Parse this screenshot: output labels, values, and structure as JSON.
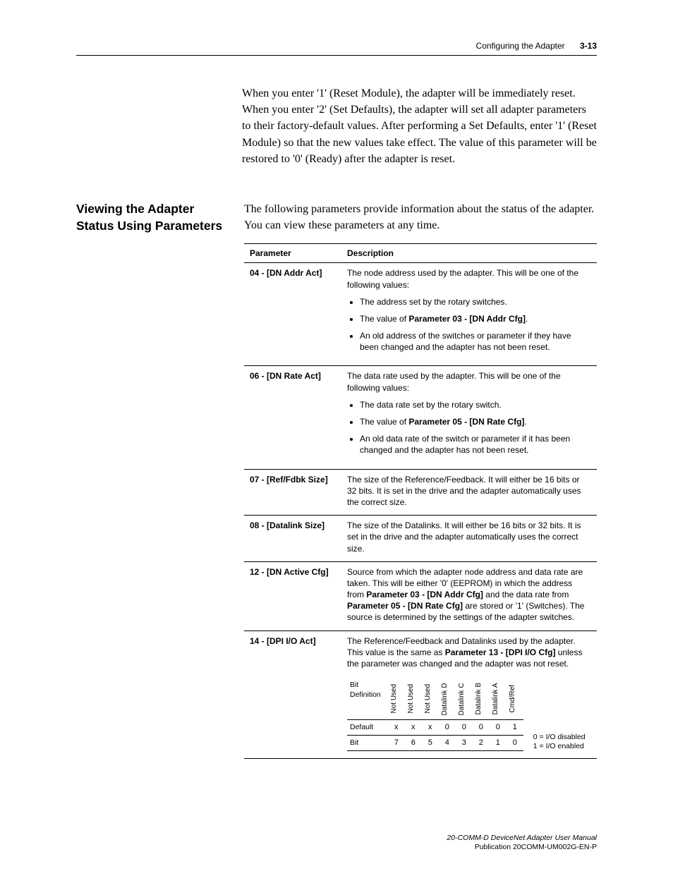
{
  "header": {
    "section": "Configuring the Adapter",
    "pagenum": "3-13"
  },
  "top_paragraph": "When you enter '1' (Reset Module), the adapter will be immediately reset. When you enter '2' (Set Defaults), the adapter will set all adapter parameters to their factory-default values. After performing a Set Defaults, enter '1' (Reset Module) so that the new values take effect. The value of this parameter will be restored to '0' (Ready) after the adapter is reset.",
  "section": {
    "heading": "Viewing the Adapter Status Using Parameters",
    "intro": "The following parameters provide information about the status of the adapter. You can view these parameters at any time."
  },
  "table": {
    "head": {
      "param": "Parameter",
      "desc": "Description"
    },
    "rows": {
      "r0": {
        "param": "04 - [DN Addr Act]",
        "desc_pre": "The node address used by the adapter. This will be one of the following values:",
        "b1": "The address set by the rotary switches.",
        "b2a": "The value of ",
        "b2b": "Parameter 03 - [DN Addr Cfg]",
        "b2c": ".",
        "b3": "An old address of the switches or parameter if they have been changed and the adapter has not been reset."
      },
      "r1": {
        "param": "06 - [DN Rate Act]",
        "desc_pre": "The data rate used by the adapter. This will be one of the following values:",
        "b1": "The data rate set by the rotary switch.",
        "b2a": "The value of ",
        "b2b": "Parameter 05 - [DN Rate Cfg]",
        "b2c": ".",
        "b3": "An old data rate of the switch or parameter if it has been changed and the adapter has not been reset."
      },
      "r2": {
        "param": "07 - [Ref/Fdbk Size]",
        "desc": "The size of the Reference/Feedback. It will either be 16 bits or 32 bits. It is set in the drive and the adapter automatically uses the correct size."
      },
      "r3": {
        "param": "08 - [Datalink Size]",
        "desc": "The size of the Datalinks. It will either be 16 bits or 32 bits. It is set in the drive and the adapter automatically uses the correct size."
      },
      "r4": {
        "param": "12 - [DN Active Cfg]",
        "d1": "Source from which the adapter node address and data rate are taken. This will be either '0' (EEPROM) in which the address from ",
        "d2": "Parameter 03 - [DN Addr Cfg]",
        "d3": " and the data rate from ",
        "d4": "Parameter 05 - [DN Rate Cfg]",
        "d5": " are stored or '1' (Switches). The source is determined by the settings of the adapter switches."
      },
      "r5": {
        "param": "14 - [DPI I/O Act]",
        "d1": "The Reference/Feedback and Datalinks used by the adapter. This value is the same as ",
        "d2": "Parameter 13 - [DPI I/O Cfg]",
        "d3": " unless the parameter was changed and the adapter was not reset."
      }
    }
  },
  "bits": {
    "row_labels": {
      "def": "Bit\nDefinition",
      "default": "Default",
      "bit": "Bit"
    },
    "cols": {
      "c7": "Not Used",
      "c6": "Not Used",
      "c5": "Not Used",
      "c4": "Datalink D",
      "c3": "Datalink C",
      "c2": "Datalink B",
      "c1": "Datalink A",
      "c0": "Cmd/Ref"
    },
    "defaults": {
      "c7": "x",
      "c6": "x",
      "c5": "x",
      "c4": "0",
      "c3": "0",
      "c2": "0",
      "c1": "0",
      "c0": "1"
    },
    "bitnums": {
      "c7": "7",
      "c6": "6",
      "c5": "5",
      "c4": "4",
      "c3": "3",
      "c2": "2",
      "c1": "1",
      "c0": "0"
    },
    "legend": {
      "l0": "0 = I/O disabled",
      "l1": "1 = I/O enabled"
    }
  },
  "footer": {
    "title": "20-COMM-D DeviceNet Adapter User Manual",
    "pub": "Publication 20COMM-UM002G-EN-P"
  }
}
